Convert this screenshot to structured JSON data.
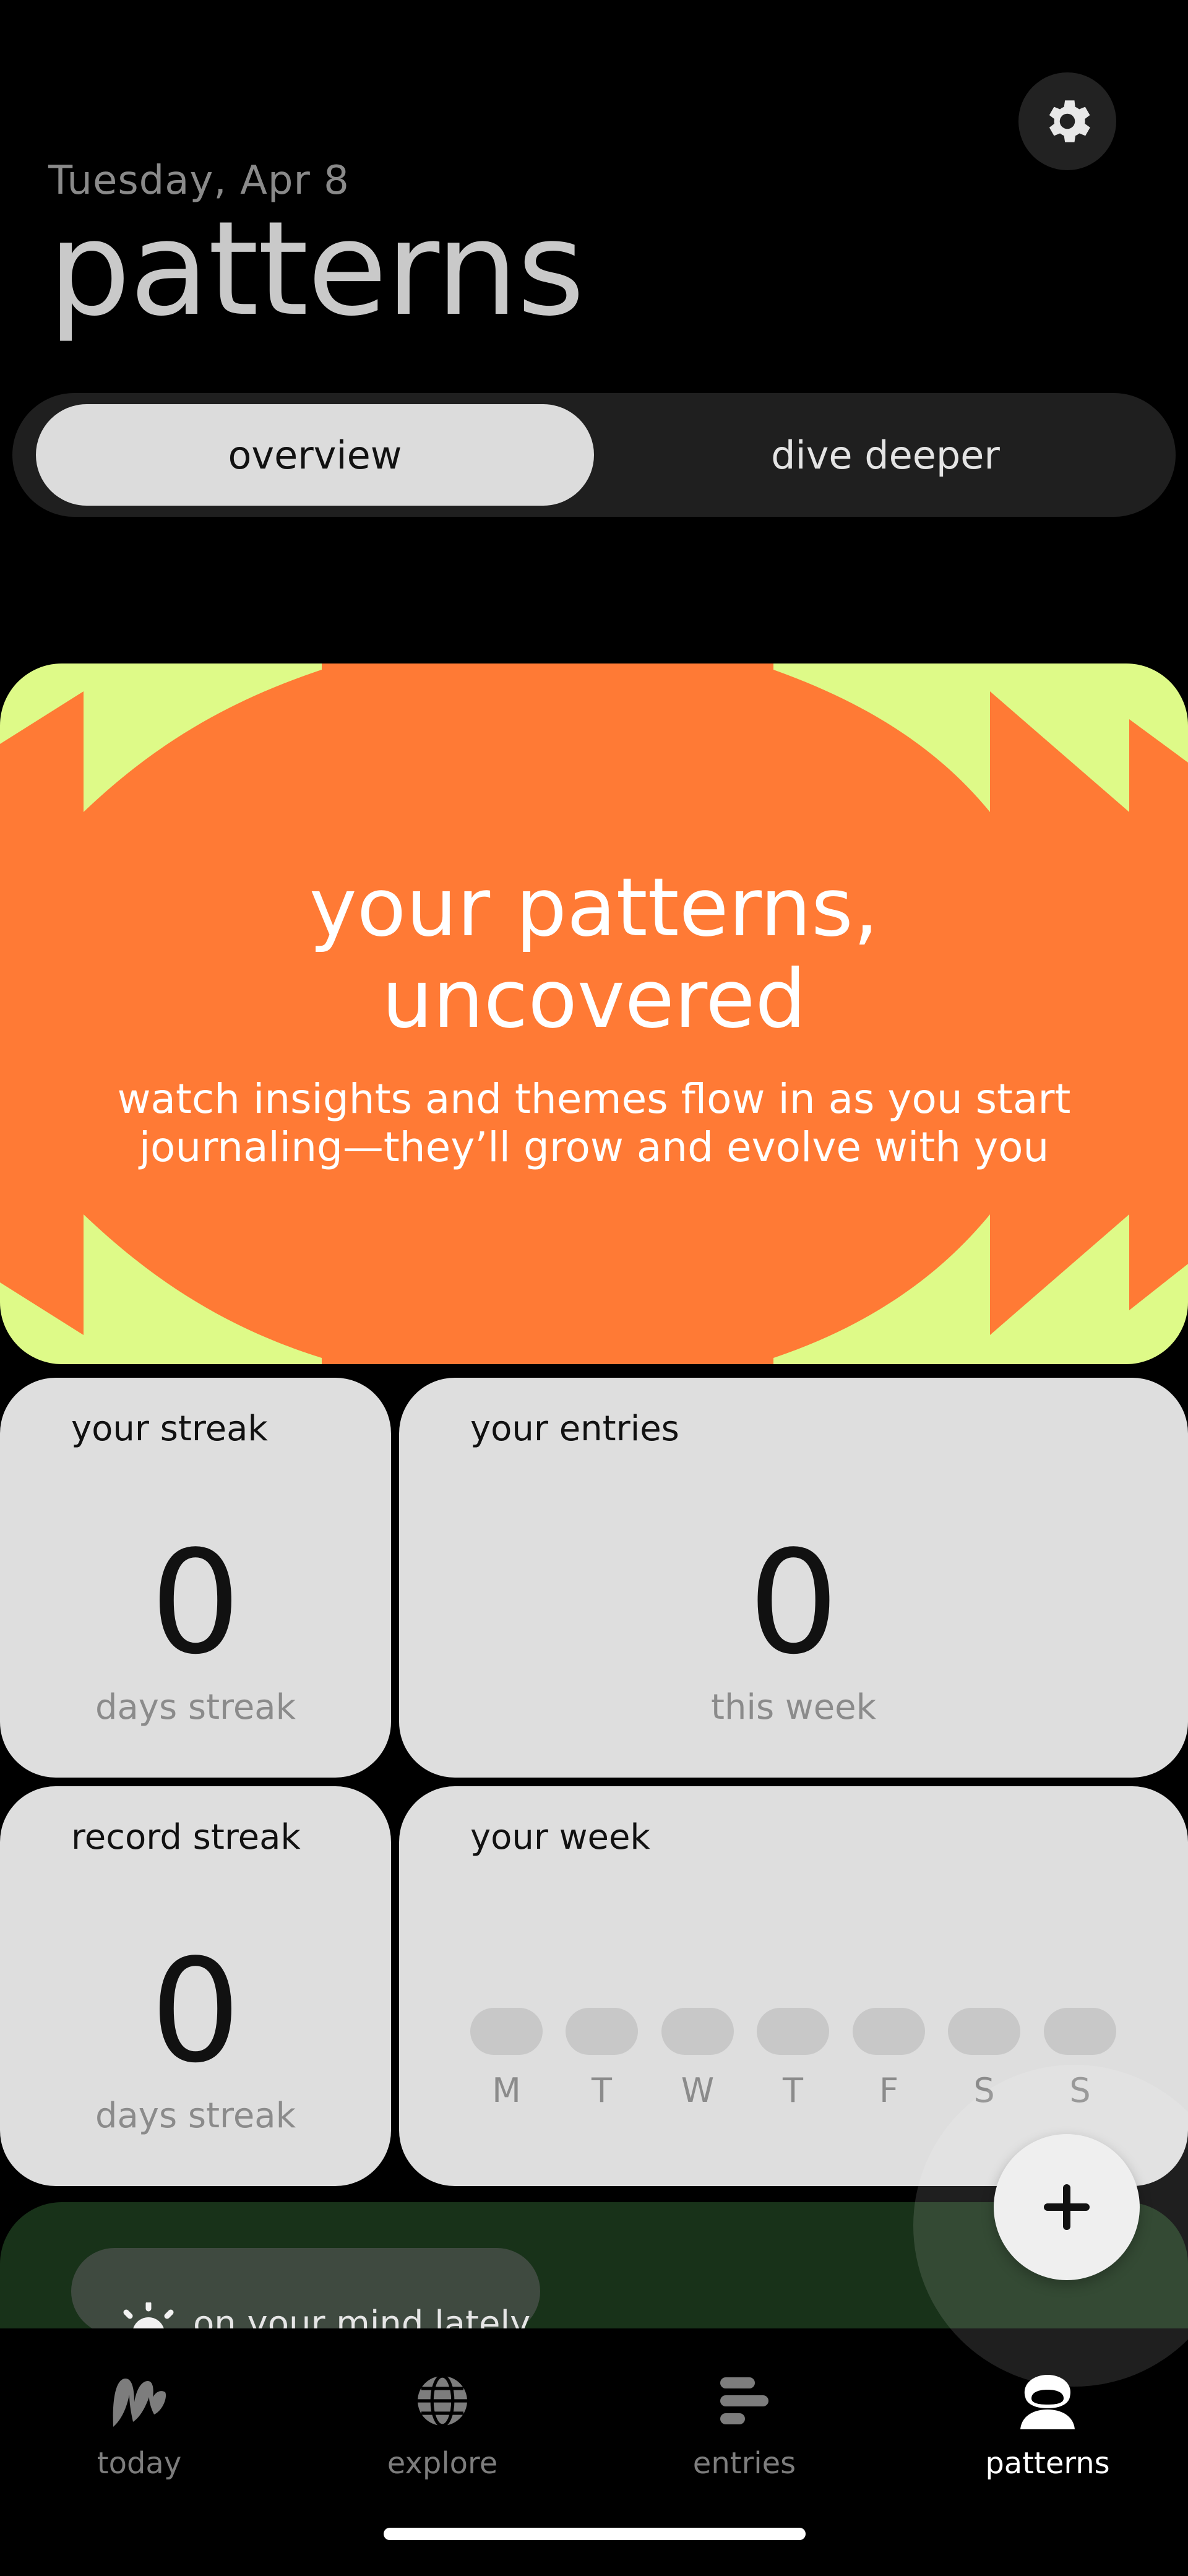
{
  "header": {
    "date": "Tuesday, Apr 8",
    "title": "patterns",
    "settings_icon": "gear-icon"
  },
  "segmented": {
    "tabs": [
      {
        "label": "overview",
        "active": true
      },
      {
        "label": "dive deeper",
        "active": false
      }
    ]
  },
  "hero": {
    "title_line1": "your patterns,",
    "title_line2": "uncovered",
    "subtitle_line1": "watch insights and themes flow in as you start",
    "subtitle_line2": "journaling—they’ll grow and evolve with you",
    "colors": {
      "background": "#defa88",
      "blob": "#ff7a35"
    }
  },
  "stats": {
    "streak": {
      "title": "your streak",
      "value": "0",
      "caption": "days streak"
    },
    "entries": {
      "title": "your entries",
      "value": "0",
      "caption": "this week"
    },
    "record": {
      "title": "record streak",
      "value": "0",
      "caption": "days streak"
    },
    "week": {
      "title": "your week",
      "days": [
        "M",
        "T",
        "W",
        "T",
        "F",
        "S",
        "S"
      ]
    }
  },
  "mind": {
    "label": "on your mind lately",
    "icon": "sun-icon",
    "color": "#183219"
  },
  "fab": {
    "icon": "plus-icon"
  },
  "nav": {
    "items": [
      {
        "label": "today",
        "icon": "today-logo-icon",
        "active": false
      },
      {
        "label": "explore",
        "icon": "globe-icon",
        "active": false
      },
      {
        "label": "entries",
        "icon": "entries-lines-icon",
        "active": false
      },
      {
        "label": "patterns",
        "icon": "patterns-face-icon",
        "active": true
      }
    ]
  }
}
